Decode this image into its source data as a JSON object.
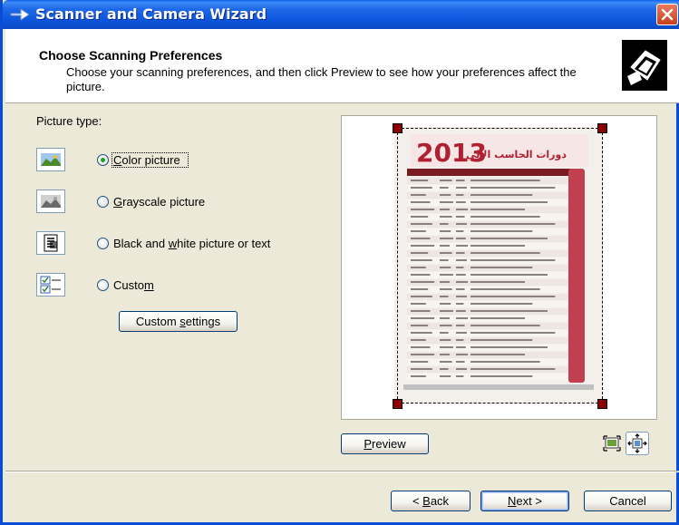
{
  "window": {
    "title": "Scanner and Camera Wizard"
  },
  "header": {
    "title": "Choose Scanning Preferences",
    "subtitle": "Choose your scanning preferences, and then click Preview to see how your preferences affect the picture."
  },
  "picture_type": {
    "label": "Picture type:",
    "options": [
      {
        "label_pre": "",
        "key": "C",
        "label_post": "olor picture",
        "selected": true,
        "icon": "color-photo-icon"
      },
      {
        "label_pre": "",
        "key": "G",
        "label_post": "rayscale picture",
        "selected": false,
        "icon": "grayscale-photo-icon"
      },
      {
        "label_pre": "Black and ",
        "key": "w",
        "label_post": "hite picture or text",
        "selected": false,
        "icon": "black-white-text-icon"
      },
      {
        "label_pre": "Custo",
        "key": "m",
        "label_post": "",
        "selected": false,
        "icon": "custom-settings-icon"
      }
    ],
    "custom_settings_pre": "Custom ",
    "custom_settings_key": "s",
    "custom_settings_post": "ettings"
  },
  "preview": {
    "button_key": "P",
    "button_post": "review",
    "doc_title_number": "2013",
    "doc_title_arabic": "دورات الحاسب الآلي"
  },
  "footer": {
    "back_pre": "< ",
    "back_key": "B",
    "back_post": "ack",
    "next_key": "N",
    "next_post": "ext >",
    "cancel": "Cancel"
  },
  "colors": {
    "titlebar": "#0A4CD6",
    "dialog_bg": "#ECE9D8",
    "handle": "#8B0000"
  }
}
